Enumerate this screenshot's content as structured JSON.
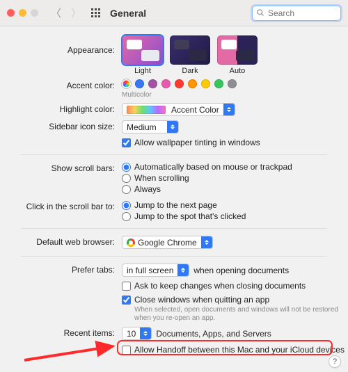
{
  "window": {
    "title": "General"
  },
  "search": {
    "placeholder": "Search"
  },
  "labels": {
    "appearance": "Appearance:",
    "accent": "Accent color:",
    "accent_sub": "Multicolor",
    "highlight": "Highlight color:",
    "sidebar": "Sidebar icon size:",
    "wallpaper_tint": "Allow wallpaper tinting in windows",
    "scrollbars": "Show scroll bars:",
    "click_scroll": "Click in the scroll bar to:",
    "browser": "Default web browser:",
    "prefer_tabs": "Prefer tabs:",
    "prefer_tabs_suffix": "when opening documents",
    "ask_keep": "Ask to keep changes when closing documents",
    "close_windows": "Close windows when quitting an app",
    "close_windows_sub": "When selected, open documents and windows will not be restored when you re-open an app.",
    "recent": "Recent items:",
    "recent_suffix": "Documents, Apps, and Servers",
    "handoff": "Allow Handoff between this Mac and your iCloud devices"
  },
  "appearance": {
    "options": [
      "Light",
      "Dark",
      "Auto"
    ],
    "selected": "Light"
  },
  "accent_colors": [
    "#ff5f57",
    "#3478f6",
    "#a550a7",
    "#e85AAD",
    "#ff3b30",
    "#ff9500",
    "#ffcc00",
    "#34c759",
    "#8e8e93"
  ],
  "accent_selected_index": 0,
  "highlight": {
    "value": "Accent Color"
  },
  "sidebar_size": {
    "value": "Medium"
  },
  "wallpaper_tint_checked": true,
  "scrollbars": {
    "options": [
      "Automatically based on mouse or trackpad",
      "When scrolling",
      "Always"
    ],
    "selected": 0
  },
  "click_scroll": {
    "options": [
      "Jump to the next page",
      "Jump to the spot that's clicked"
    ],
    "selected": 0
  },
  "browser": {
    "value": "Google Chrome"
  },
  "prefer_tabs": {
    "value": "in full screen"
  },
  "ask_keep_checked": false,
  "close_windows_checked": true,
  "recent_items": {
    "value": "10"
  },
  "handoff_checked": false,
  "help": "?"
}
